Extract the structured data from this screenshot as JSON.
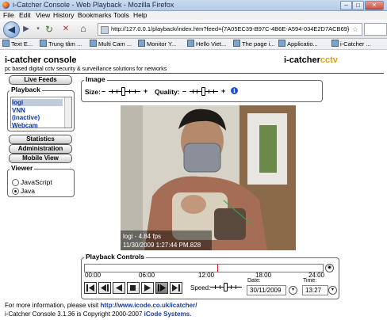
{
  "window": {
    "title": "i-Catcher Console - Web Playback - Mozilla Firefox",
    "min": "–",
    "max": "□",
    "close": "✕"
  },
  "menu": [
    "File",
    "Edit",
    "View",
    "History",
    "Bookmarks",
    "Tools",
    "Help"
  ],
  "nav": {
    "url": "http://127.0.0.1/playback/index.htm?feed={7A05EC39-B97C-4B6E-A594-034E2D7ACB69}"
  },
  "bookmarks": [
    "Text E...",
    "Trung tâm ...",
    "Multi Cam ...",
    "Monitor Y...",
    "Hello Viet...",
    "The page i...",
    "Applicatio...",
    "i-Catcher ..."
  ],
  "header": {
    "title": "i-catcher console",
    "subtitle": "pc based digital cctv security & surveillance solutions for networks",
    "logo_a": "i-catcher",
    "logo_b": "cctv"
  },
  "sidebar": {
    "live_feeds": "Live Feeds",
    "playback_legend": "Playback",
    "playlist": [
      "logi",
      "VNN",
      "(inactive)",
      "Webcam"
    ],
    "statistics": "Statistics",
    "administration": "Administration",
    "mobile_view": "Mobile View",
    "viewer_legend": "Viewer",
    "viewer_options": [
      "JavaScript",
      "Java"
    ],
    "viewer_selected": "Java"
  },
  "image_panel": {
    "legend": "Image",
    "size_label": "Size:",
    "quality_label": "Quality:",
    "minus": "–",
    "plus": "+",
    "info": "i"
  },
  "camera": {
    "overlay_line1": "logi - 4.84 fps",
    "overlay_line2": "11/30/2009 1:27:44 PM.828"
  },
  "playback": {
    "legend": "Playback Controls",
    "times": [
      "00:00",
      "06:00",
      "12:00",
      "18:00",
      "24:00"
    ],
    "speed_label": "Speed:",
    "date_label": "Date:",
    "date": "30/11/2009",
    "time_label": "Time:",
    "time": "13:27",
    "position": 0.56
  },
  "footer": {
    "line1_text": "For more information, please visit ",
    "line1_link": "http://www.icode.co.uk/icatcher/",
    "line2_text": "i-Catcher Console 3.1.36 is Copyright 2000-2007 ",
    "line2_link": "iCode Systems."
  }
}
